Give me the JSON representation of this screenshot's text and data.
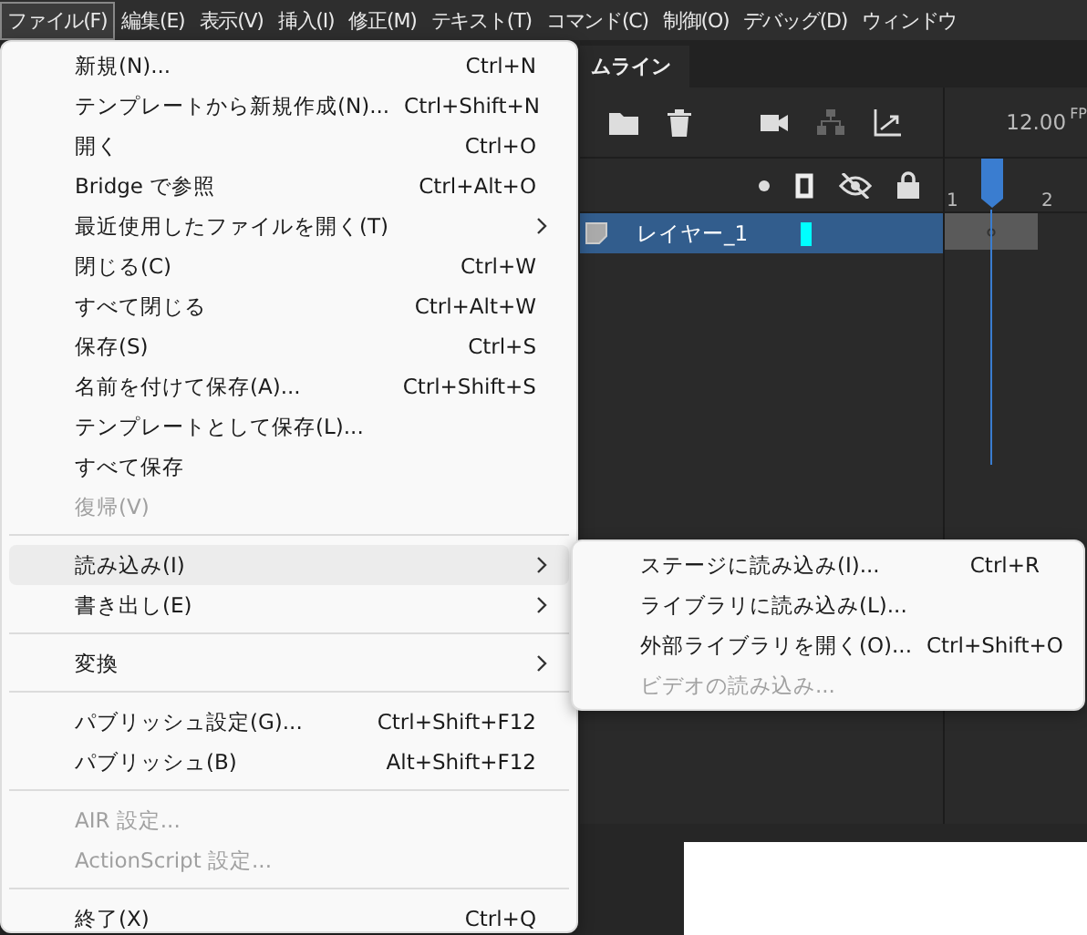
{
  "menubar": [
    {
      "label": "ファイル(F)",
      "selected": true
    },
    {
      "label": "編集(E)",
      "selected": false
    },
    {
      "label": "表示(V)",
      "selected": false
    },
    {
      "label": "挿入(I)",
      "selected": false
    },
    {
      "label": "修正(M)",
      "selected": false
    },
    {
      "label": "テキスト(T)",
      "selected": false
    },
    {
      "label": "コマンド(C)",
      "selected": false
    },
    {
      "label": "制御(O)",
      "selected": false
    },
    {
      "label": "デバッグ(D)",
      "selected": false
    },
    {
      "label": "ウィンドウ",
      "selected": false
    }
  ],
  "timeline": {
    "tab": "ムライン",
    "fps": "12.00",
    "fps_unit": "FP",
    "frame_numbers": [
      "1",
      "2"
    ],
    "layers": [
      {
        "name": "レイヤー_1",
        "selected": true,
        "color": "#00ffff"
      }
    ]
  },
  "file_menu": [
    {
      "kind": "item",
      "label": "新規(N)...",
      "shortcut": "Ctrl+N",
      "disabled": false,
      "selected": false
    },
    {
      "kind": "item",
      "label": "テンプレートから新規作成(N)...",
      "shortcut": "Ctrl+Shift+N",
      "disabled": false,
      "selected": false
    },
    {
      "kind": "item",
      "label": "開く",
      "shortcut": "Ctrl+O",
      "disabled": false,
      "selected": false
    },
    {
      "kind": "item",
      "label": "Bridge で参照",
      "shortcut": "Ctrl+Alt+O",
      "disabled": false,
      "selected": false
    },
    {
      "kind": "submenu",
      "label": "最近使用したファイルを開く(T)",
      "disabled": false,
      "selected": false
    },
    {
      "kind": "item",
      "label": "閉じる(C)",
      "shortcut": "Ctrl+W",
      "disabled": false,
      "selected": false
    },
    {
      "kind": "item",
      "label": "すべて閉じる",
      "shortcut": "Ctrl+Alt+W",
      "disabled": false,
      "selected": false
    },
    {
      "kind": "item",
      "label": "保存(S)",
      "shortcut": "Ctrl+S",
      "disabled": false,
      "selected": false
    },
    {
      "kind": "item",
      "label": "名前を付けて保存(A)...",
      "shortcut": "Ctrl+Shift+S",
      "disabled": false,
      "selected": false
    },
    {
      "kind": "item",
      "label": "テンプレートとして保存(L)...",
      "disabled": false,
      "selected": false
    },
    {
      "kind": "item",
      "label": "すべて保存",
      "disabled": false,
      "selected": false
    },
    {
      "kind": "item",
      "label": "復帰(V)",
      "disabled": true,
      "selected": false
    },
    {
      "kind": "separator"
    },
    {
      "kind": "submenu",
      "label": "読み込み(I)",
      "disabled": false,
      "selected": true
    },
    {
      "kind": "submenu",
      "label": "書き出し(E)",
      "disabled": false,
      "selected": false
    },
    {
      "kind": "separator"
    },
    {
      "kind": "submenu",
      "label": "変換",
      "disabled": false,
      "selected": false
    },
    {
      "kind": "separator"
    },
    {
      "kind": "item",
      "label": "パブリッシュ設定(G)...",
      "shortcut": "Ctrl+Shift+F12",
      "disabled": false,
      "selected": false
    },
    {
      "kind": "item",
      "label": "パブリッシュ(B)",
      "shortcut": "Alt+Shift+F12",
      "disabled": false,
      "selected": false
    },
    {
      "kind": "separator"
    },
    {
      "kind": "item",
      "label": "AIR 設定...",
      "disabled": true,
      "selected": false
    },
    {
      "kind": "item",
      "label": "ActionScript 設定...",
      "disabled": true,
      "selected": false
    },
    {
      "kind": "separator"
    },
    {
      "kind": "item",
      "label": "終了(X)",
      "shortcut": "Ctrl+Q",
      "disabled": false,
      "selected": false
    }
  ],
  "import_submenu": [
    {
      "kind": "item",
      "label": "ステージに読み込み(I)...",
      "shortcut": "Ctrl+R",
      "disabled": false,
      "selected": false
    },
    {
      "kind": "item",
      "label": "ライブラリに読み込み(L)...",
      "disabled": false,
      "selected": false
    },
    {
      "kind": "item",
      "label": "外部ライブラリを開く(O)...",
      "shortcut": "Ctrl+Shift+O",
      "disabled": false,
      "selected": false
    },
    {
      "kind": "item",
      "label": "ビデオの読み込み...",
      "disabled": true,
      "selected": false
    }
  ]
}
